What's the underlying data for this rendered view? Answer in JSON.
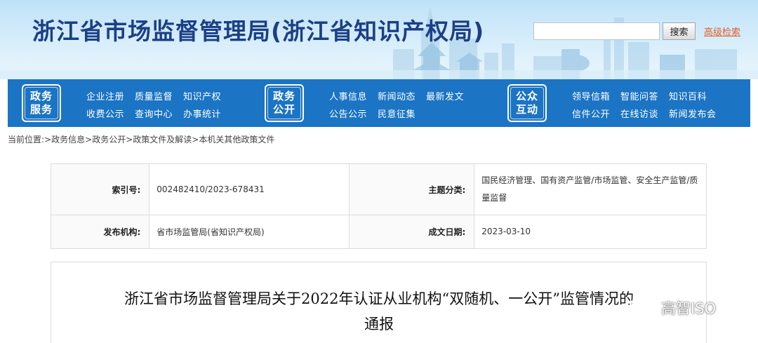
{
  "header": {
    "site_title": "浙江省市场监督管理局(浙江省知识产权局)",
    "search_placeholder": "",
    "search_button": "搜索",
    "advanced_search": "高级检索"
  },
  "nav": {
    "groups": [
      {
        "badge": [
          "政务",
          "服务"
        ],
        "links": [
          "企业注册",
          "质量监督",
          "知识产权",
          "收费公示",
          "查询中心",
          "办事统计"
        ]
      },
      {
        "badge": [
          "政务",
          "公开"
        ],
        "links": [
          "人事信息",
          "新闻动态",
          "最新发文",
          "公告公示",
          "民意征集"
        ]
      },
      {
        "badge": [
          "公众",
          "互动"
        ],
        "links": [
          "领导信箱",
          "智能问答",
          "知识百科",
          "信件公开",
          "在线访谈",
          "新闻发布会"
        ]
      }
    ]
  },
  "breadcrumb": {
    "prefix": "当前位置:",
    "items": [
      "政务信息",
      "政务公开",
      "政策文件及解读",
      "本机关其他政策文件"
    ],
    "separator": ">"
  },
  "meta": {
    "index_label": "索引号:",
    "index_value": "002482410/2023-678431",
    "topic_label": "主题分类:",
    "topic_value": "国民经济管理、国有资产监管/市场监管、安全生产监管/质量监督",
    "publisher_label": "发布机构:",
    "publisher_value": "省市场监管局(省知识产权局)",
    "date_label": "成文日期:",
    "date_value": "2023-03-10"
  },
  "document": {
    "title_line1": "浙江省市场监督管理局关于2022年认证从业机构“双随机、一公开”监管情况的",
    "title_line2": "通报"
  },
  "watermark": {
    "text": "高智ISO",
    "icon": "wechat-icon"
  },
  "colors": {
    "title_blue": "#1c3f86",
    "nav_blue": "#1b74c4",
    "link_orange": "#e0622a"
  }
}
